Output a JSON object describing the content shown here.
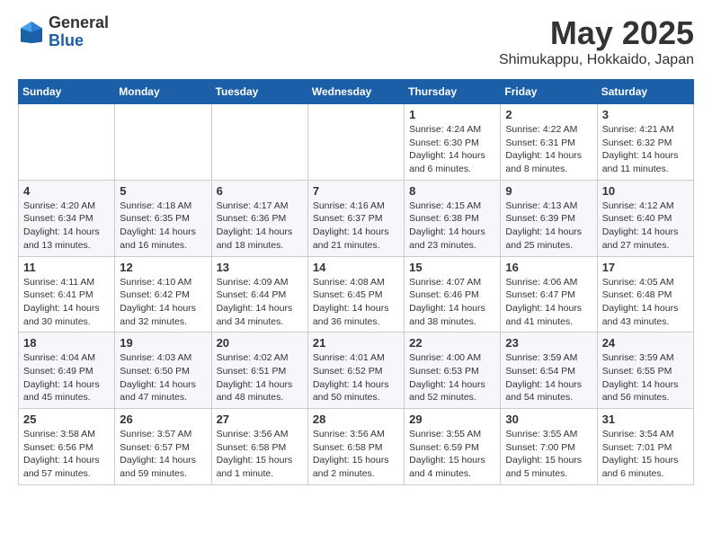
{
  "logo": {
    "general": "General",
    "blue": "Blue"
  },
  "title": "May 2025",
  "location": "Shimukappu, Hokkaido, Japan",
  "days_of_week": [
    "Sunday",
    "Monday",
    "Tuesday",
    "Wednesday",
    "Thursday",
    "Friday",
    "Saturday"
  ],
  "weeks": [
    [
      {
        "day": "",
        "info": ""
      },
      {
        "day": "",
        "info": ""
      },
      {
        "day": "",
        "info": ""
      },
      {
        "day": "",
        "info": ""
      },
      {
        "day": "1",
        "info": "Sunrise: 4:24 AM\nSunset: 6:30 PM\nDaylight: 14 hours\nand 6 minutes."
      },
      {
        "day": "2",
        "info": "Sunrise: 4:22 AM\nSunset: 6:31 PM\nDaylight: 14 hours\nand 8 minutes."
      },
      {
        "day": "3",
        "info": "Sunrise: 4:21 AM\nSunset: 6:32 PM\nDaylight: 14 hours\nand 11 minutes."
      }
    ],
    [
      {
        "day": "4",
        "info": "Sunrise: 4:20 AM\nSunset: 6:34 PM\nDaylight: 14 hours\nand 13 minutes."
      },
      {
        "day": "5",
        "info": "Sunrise: 4:18 AM\nSunset: 6:35 PM\nDaylight: 14 hours\nand 16 minutes."
      },
      {
        "day": "6",
        "info": "Sunrise: 4:17 AM\nSunset: 6:36 PM\nDaylight: 14 hours\nand 18 minutes."
      },
      {
        "day": "7",
        "info": "Sunrise: 4:16 AM\nSunset: 6:37 PM\nDaylight: 14 hours\nand 21 minutes."
      },
      {
        "day": "8",
        "info": "Sunrise: 4:15 AM\nSunset: 6:38 PM\nDaylight: 14 hours\nand 23 minutes."
      },
      {
        "day": "9",
        "info": "Sunrise: 4:13 AM\nSunset: 6:39 PM\nDaylight: 14 hours\nand 25 minutes."
      },
      {
        "day": "10",
        "info": "Sunrise: 4:12 AM\nSunset: 6:40 PM\nDaylight: 14 hours\nand 27 minutes."
      }
    ],
    [
      {
        "day": "11",
        "info": "Sunrise: 4:11 AM\nSunset: 6:41 PM\nDaylight: 14 hours\nand 30 minutes."
      },
      {
        "day": "12",
        "info": "Sunrise: 4:10 AM\nSunset: 6:42 PM\nDaylight: 14 hours\nand 32 minutes."
      },
      {
        "day": "13",
        "info": "Sunrise: 4:09 AM\nSunset: 6:44 PM\nDaylight: 14 hours\nand 34 minutes."
      },
      {
        "day": "14",
        "info": "Sunrise: 4:08 AM\nSunset: 6:45 PM\nDaylight: 14 hours\nand 36 minutes."
      },
      {
        "day": "15",
        "info": "Sunrise: 4:07 AM\nSunset: 6:46 PM\nDaylight: 14 hours\nand 38 minutes."
      },
      {
        "day": "16",
        "info": "Sunrise: 4:06 AM\nSunset: 6:47 PM\nDaylight: 14 hours\nand 41 minutes."
      },
      {
        "day": "17",
        "info": "Sunrise: 4:05 AM\nSunset: 6:48 PM\nDaylight: 14 hours\nand 43 minutes."
      }
    ],
    [
      {
        "day": "18",
        "info": "Sunrise: 4:04 AM\nSunset: 6:49 PM\nDaylight: 14 hours\nand 45 minutes."
      },
      {
        "day": "19",
        "info": "Sunrise: 4:03 AM\nSunset: 6:50 PM\nDaylight: 14 hours\nand 47 minutes."
      },
      {
        "day": "20",
        "info": "Sunrise: 4:02 AM\nSunset: 6:51 PM\nDaylight: 14 hours\nand 48 minutes."
      },
      {
        "day": "21",
        "info": "Sunrise: 4:01 AM\nSunset: 6:52 PM\nDaylight: 14 hours\nand 50 minutes."
      },
      {
        "day": "22",
        "info": "Sunrise: 4:00 AM\nSunset: 6:53 PM\nDaylight: 14 hours\nand 52 minutes."
      },
      {
        "day": "23",
        "info": "Sunrise: 3:59 AM\nSunset: 6:54 PM\nDaylight: 14 hours\nand 54 minutes."
      },
      {
        "day": "24",
        "info": "Sunrise: 3:59 AM\nSunset: 6:55 PM\nDaylight: 14 hours\nand 56 minutes."
      }
    ],
    [
      {
        "day": "25",
        "info": "Sunrise: 3:58 AM\nSunset: 6:56 PM\nDaylight: 14 hours\nand 57 minutes."
      },
      {
        "day": "26",
        "info": "Sunrise: 3:57 AM\nSunset: 6:57 PM\nDaylight: 14 hours\nand 59 minutes."
      },
      {
        "day": "27",
        "info": "Sunrise: 3:56 AM\nSunset: 6:58 PM\nDaylight: 15 hours\nand 1 minute."
      },
      {
        "day": "28",
        "info": "Sunrise: 3:56 AM\nSunset: 6:58 PM\nDaylight: 15 hours\nand 2 minutes."
      },
      {
        "day": "29",
        "info": "Sunrise: 3:55 AM\nSunset: 6:59 PM\nDaylight: 15 hours\nand 4 minutes."
      },
      {
        "day": "30",
        "info": "Sunrise: 3:55 AM\nSunset: 7:00 PM\nDaylight: 15 hours\nand 5 minutes."
      },
      {
        "day": "31",
        "info": "Sunrise: 3:54 AM\nSunset: 7:01 PM\nDaylight: 15 hours\nand 6 minutes."
      }
    ]
  ]
}
